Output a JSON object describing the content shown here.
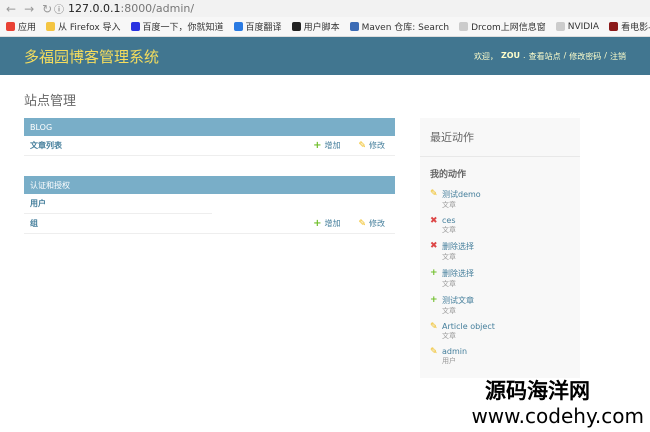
{
  "browser": {
    "url_host": "127.0.0.1",
    "url_rest": ":8000/admin/",
    "bookmarks": [
      {
        "label": "应用",
        "icon": "apps-icon",
        "color": "#e94235"
      },
      {
        "label": "从 Firefox 导入",
        "icon": "folder-icon",
        "color": "#f4c542"
      },
      {
        "label": "百度一下，你就知道",
        "icon": "baidu-icon",
        "color": "#2932e1"
      },
      {
        "label": "百度翻译",
        "icon": "translate-icon",
        "color": "#2a7ae2"
      },
      {
        "label": "用户脚本",
        "icon": "script-icon",
        "color": "#222222"
      },
      {
        "label": "Maven 仓库: Search",
        "icon": "maven-icon",
        "color": "#3b6bb5"
      },
      {
        "label": "Drcom上网信息窗",
        "icon": "page-icon",
        "color": "#cccccc"
      },
      {
        "label": "NVIDIA",
        "icon": "page-icon",
        "color": "#cccccc"
      },
      {
        "label": "看电影-琪琅",
        "icon": "movie-icon",
        "color": "#8b1a1a"
      }
    ]
  },
  "header": {
    "site_name": "多福园博客管理系统",
    "welcome": "欢迎，",
    "username": "ZOU",
    "sep": ".",
    "view_site": "查看站点",
    "slash1": "/",
    "change_password": "修改密码",
    "slash2": "/",
    "logout": "注销"
  },
  "page_title": "站点管理",
  "modules": [
    {
      "caption": "BLOG",
      "rows": [
        {
          "label": "文章列表",
          "add": "增加",
          "change": "修改"
        }
      ]
    },
    {
      "caption": "认证和授权",
      "rows": [
        {
          "label": "用户",
          "add": "",
          "change": ""
        },
        {
          "label": "组",
          "add": "增加",
          "change": "修改"
        }
      ]
    }
  ],
  "sidebar": {
    "title": "最近动作",
    "subtitle": "我的动作",
    "items": [
      {
        "action": "change",
        "name": "测试demo",
        "type": "文章"
      },
      {
        "action": "delete",
        "name": "ces",
        "type": "文章"
      },
      {
        "action": "delete",
        "name": "删除选择",
        "type": "文章"
      },
      {
        "action": "add",
        "name": "删除选择",
        "type": "文章"
      },
      {
        "action": "add",
        "name": "测试文章",
        "type": "文章"
      },
      {
        "action": "change",
        "name": "Article object",
        "type": "文章"
      },
      {
        "action": "change",
        "name": "admin",
        "type": "用户"
      }
    ]
  },
  "watermark": {
    "line1": "源码海洋网",
    "line2": "www.codehy.com"
  },
  "colors": {
    "header_bg": "#417690",
    "site_name": "#f5dd5d",
    "caption_bg": "#79aec8",
    "link": "#447e9b",
    "add": "#70bf2b",
    "change": "#efb80b",
    "delete": "#dd4646"
  }
}
